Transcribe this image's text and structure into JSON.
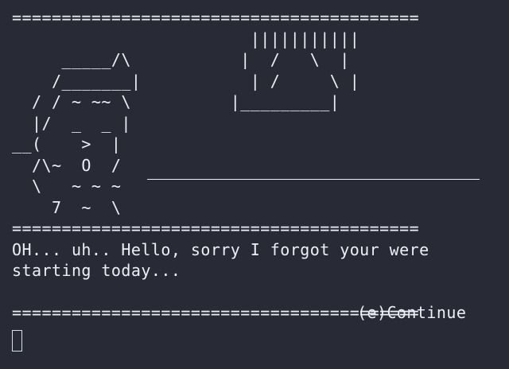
{
  "screen": {
    "top_rule": "=========================================",
    "art_lines": [
      "                        |||||||||||",
      "     _____/\\           |  /   \\  |",
      "    /_______|           | /     \\ |",
      "  / / ~ ~~ \\          |_________|",
      "  |/  _  _ |",
      "__(    >  |",
      "  /\\~  O  /",
      "  \\   ~ ~ ~",
      "    7  ~  \\"
    ],
    "middle_rule": "=========================================",
    "dialogue": [
      "OH... uh.. Hello, sorry I forgot your were",
      "starting today..."
    ],
    "continue_option": "(e)Continue",
    "bottom_rule": "========================================="
  }
}
